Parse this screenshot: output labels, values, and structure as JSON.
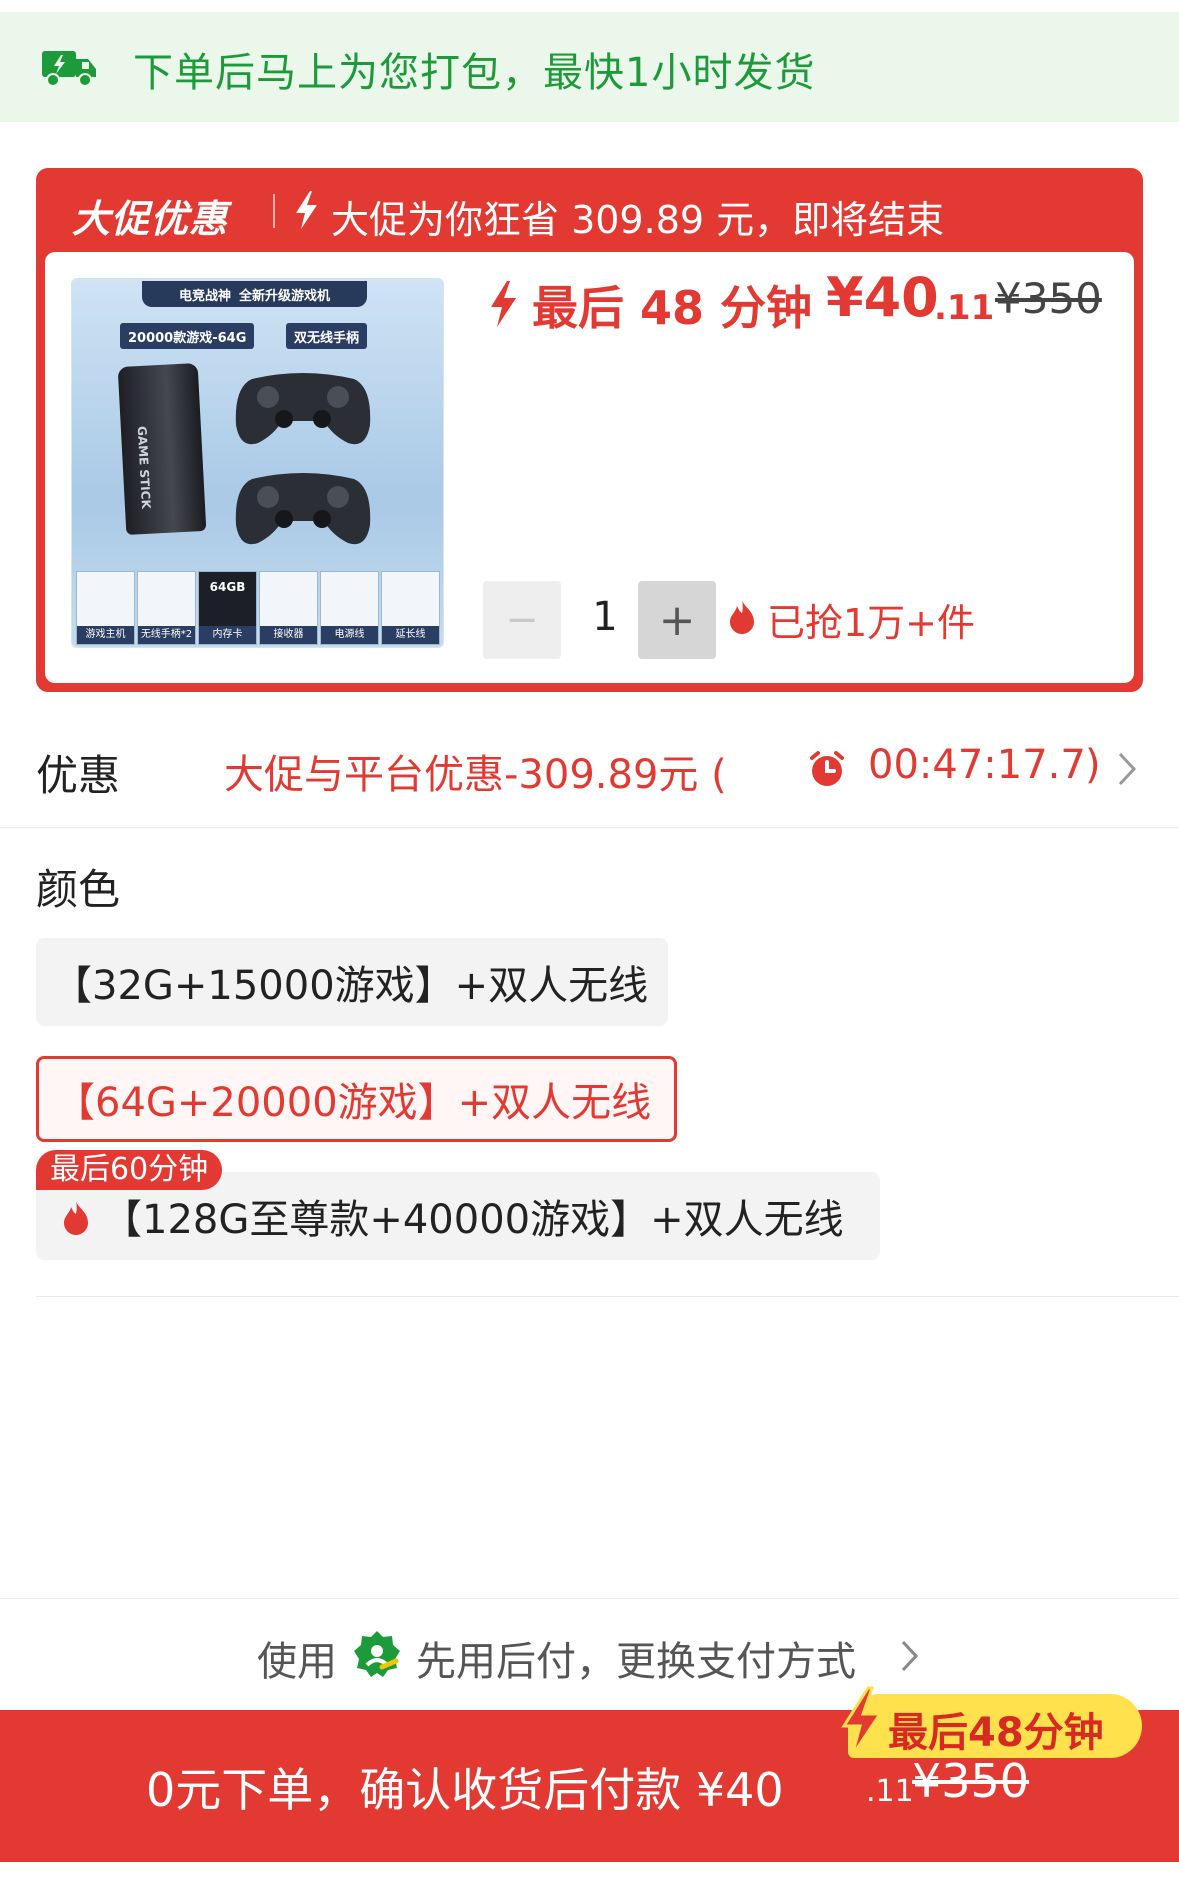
{
  "shipping": {
    "icon": "delivery-truck-icon",
    "text": "下单后马上为您打包，最快1小时发货"
  },
  "promo": {
    "title": "大促优惠",
    "subtitle": "大促为你狂省 309.89 元，即将结束",
    "price_prefix": "最后 48 分钟",
    "price_main": "¥40",
    "price_decimal": ".11",
    "price_original": "¥350",
    "quantity": "1",
    "quantity_minus": "−",
    "quantity_plus": "+",
    "sold_text": "已抢1万+件",
    "accent_color": "#e23a33"
  },
  "product_image": {
    "top_brand": "电竞战神",
    "top_label": "全新升级游戏机",
    "chip_left": "20000款游戏-64G",
    "chip_right": "双无线手柄",
    "stick_text": "GAME STICK",
    "thumbs": [
      {
        "label": "游戏主机",
        "glyph": ""
      },
      {
        "label": "无线手柄*2",
        "glyph": ""
      },
      {
        "label": "内存卡",
        "glyph": "64GB"
      },
      {
        "label": "接收器",
        "glyph": ""
      },
      {
        "label": "电源线",
        "glyph": ""
      },
      {
        "label": "延长线",
        "glyph": ""
      }
    ]
  },
  "coupon": {
    "label": "优惠",
    "value": "大促与平台优惠-309.89元 (",
    "time": "00:47:17.7",
    "close": ")"
  },
  "color": {
    "label": "颜色",
    "options": [
      {
        "label": "【32G+15000游戏】+双人无线",
        "selected": false
      },
      {
        "label": "【64G+20000游戏】+双人无线",
        "selected": true
      },
      {
        "label": "【128G至尊款+40000游戏】+双人无线",
        "selected": false
      }
    ],
    "option3_tag": "最后60分钟"
  },
  "payment": {
    "use": "使用",
    "text": "先用后付，更换支付方式"
  },
  "bottom": {
    "main": "0元下单，确认收货后付款 ¥40",
    "decimal": ".11",
    "original": "¥350",
    "tag": "最后48分钟"
  }
}
